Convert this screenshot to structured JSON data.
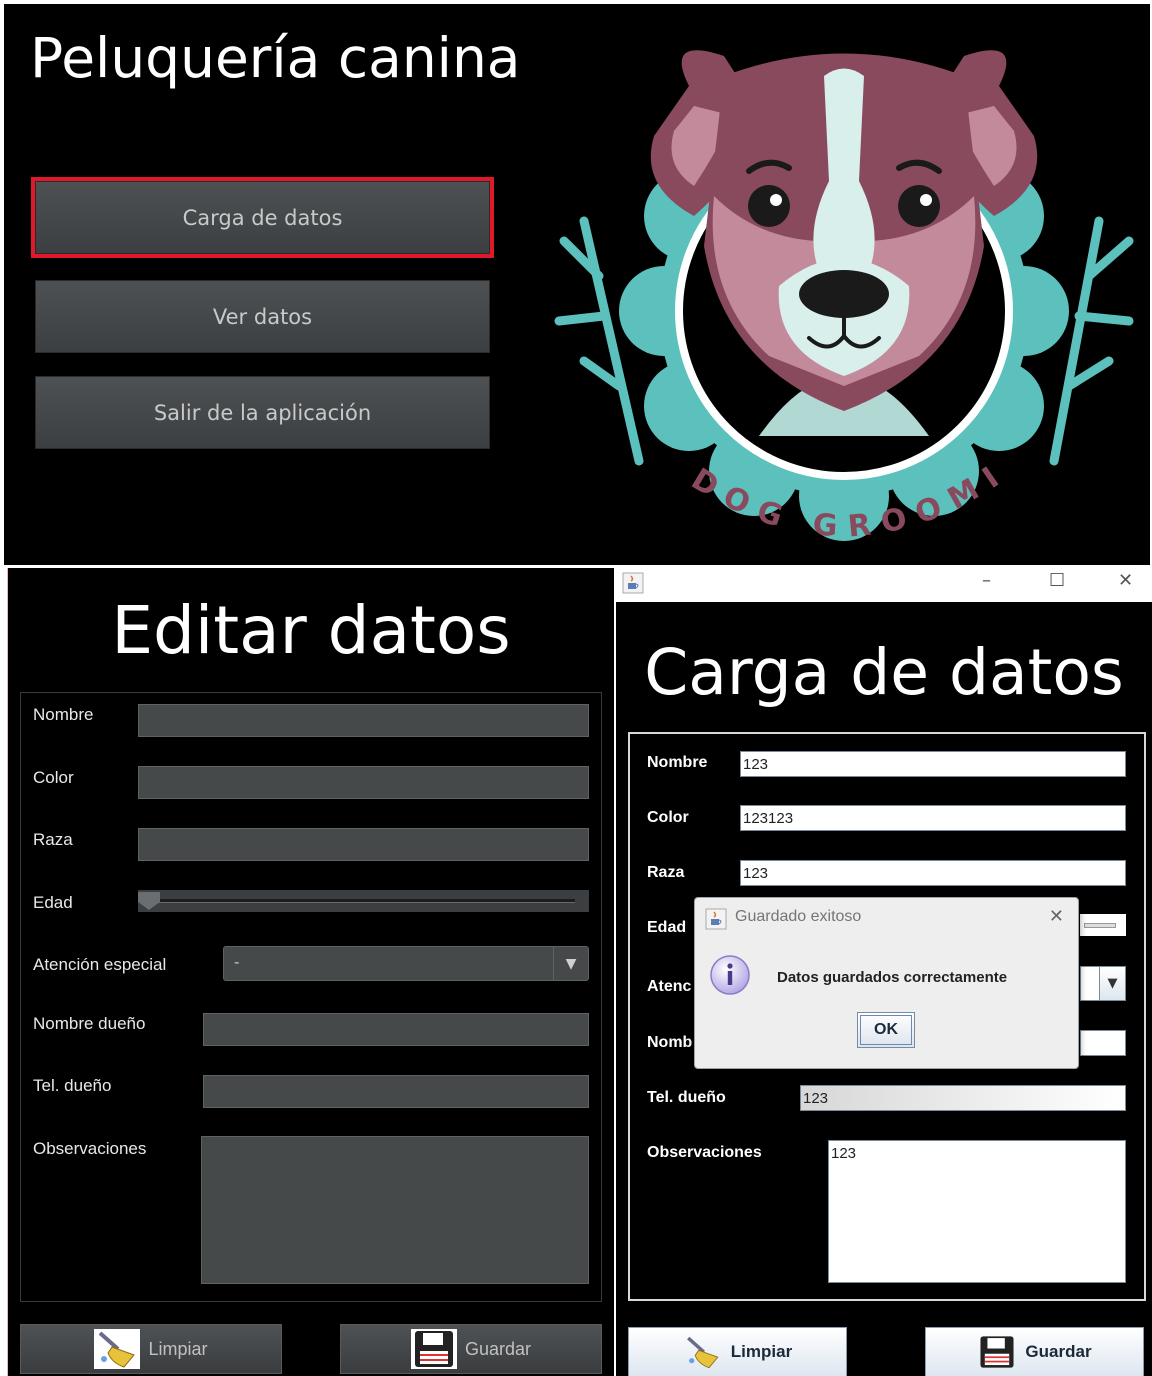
{
  "menu": {
    "title": "Peluquería canina",
    "buttons": [
      "Carga de datos",
      "Ver datos",
      "Salir de la aplicación"
    ],
    "logo_text": "DOG GROOMING",
    "focus_color": "#e0192a"
  },
  "edit": {
    "title": "Editar datos",
    "labels": {
      "nombre": "Nombre",
      "color": "Color",
      "raza": "Raza",
      "edad": "Edad",
      "atencion": "Atención especial",
      "nombre_dueno": "Nombre dueño",
      "tel_dueno": "Tel. dueño",
      "observaciones": "Observaciones"
    },
    "atencion_value": "-",
    "edad_value": 0,
    "clear_label": "Limpiar",
    "save_label": "Guardar"
  },
  "carga": {
    "title": "Carga de datos",
    "labels": {
      "nombre": "Nombre",
      "color": "Color",
      "raza": "Raza",
      "edad": "Edad",
      "atencion": "Atenc",
      "nombre_dueno": "Nomb",
      "tel_dueno": "Tel. dueño",
      "observaciones": "Observaciones"
    },
    "values": {
      "nombre": "123",
      "color": "123123",
      "raza": "123",
      "tel_dueno": "123",
      "observaciones": "123"
    },
    "clear_label": "Limpiar",
    "save_label": "Guardar",
    "window_controls": [
      "–",
      "☐",
      "✕"
    ]
  },
  "dialog": {
    "title": "Guardado exitoso",
    "message": "Datos guardados correctamente",
    "ok_label": "OK"
  }
}
